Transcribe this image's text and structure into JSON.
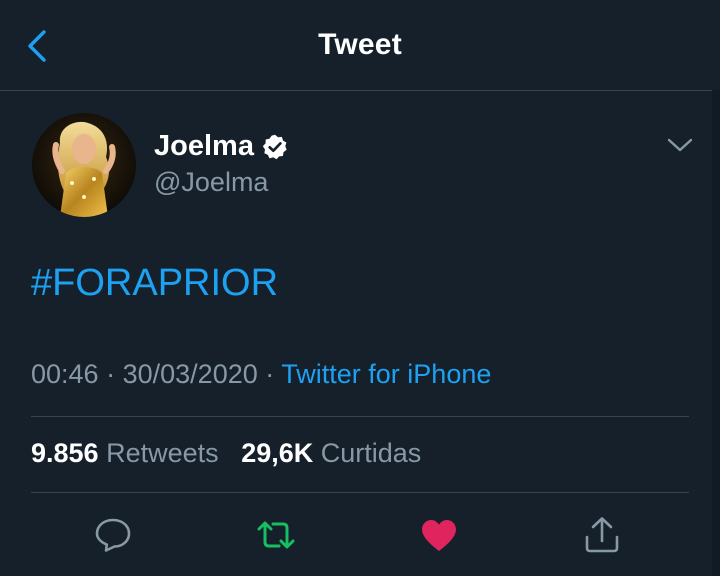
{
  "header": {
    "title": "Tweet",
    "back_icon": "chevron-left-icon"
  },
  "tweet": {
    "author": {
      "display_name": "Joelma",
      "handle": "@Joelma",
      "verified": true
    },
    "text": "#FORAPRIOR",
    "time": "00:46",
    "separator": "·",
    "date": "30/03/2020",
    "source": "Twitter for iPhone",
    "stats": {
      "retweets_count": "9.856",
      "retweets_label": "Retweets",
      "likes_count": "29,6K",
      "likes_label": "Curtidas"
    }
  },
  "actions": [
    {
      "name": "reply",
      "icon": "comment-icon"
    },
    {
      "name": "retweet",
      "icon": "retweet-icon"
    },
    {
      "name": "like",
      "icon": "heart-icon"
    },
    {
      "name": "share",
      "icon": "share-icon"
    }
  ],
  "colors": {
    "background": "#15202b",
    "accent_blue": "#1da1f2",
    "muted_text": "#8899a6",
    "divider": "#38444d",
    "retweet_green": "#17bf63",
    "like_pink": "#e0245e"
  }
}
